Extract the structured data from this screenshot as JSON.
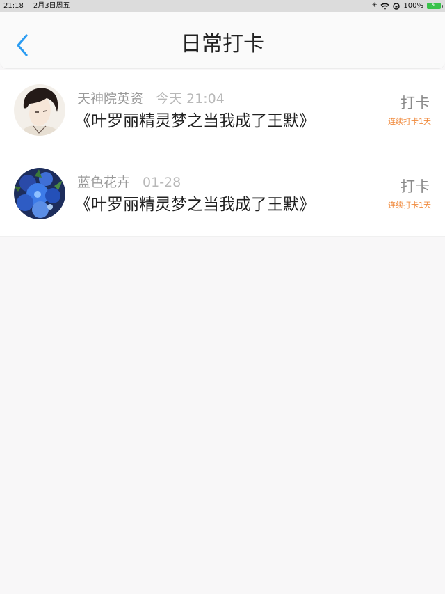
{
  "status_bar": {
    "time": "21:18",
    "date": "2月3日周五",
    "battery": "100%"
  },
  "nav": {
    "title": "日常打卡"
  },
  "checkins": [
    {
      "user": "天神院英资",
      "time": "今天 21:04",
      "book": "《叶罗丽精灵梦之当我成了王默》",
      "action": "打卡",
      "streak": "连续打卡1天"
    },
    {
      "user": "蓝色花卉",
      "time": "01-28",
      "book": "《叶罗丽精灵梦之当我成了王默》",
      "action": "打卡",
      "streak": "连续打卡1天"
    }
  ],
  "colors": {
    "accent": "#2b9cf2",
    "streak": "#f08a3c",
    "battery": "#39c24a"
  },
  "icons": {
    "back": "chevron-left-icon",
    "wifi": "wifi-icon",
    "battery": "battery-charging-icon"
  }
}
